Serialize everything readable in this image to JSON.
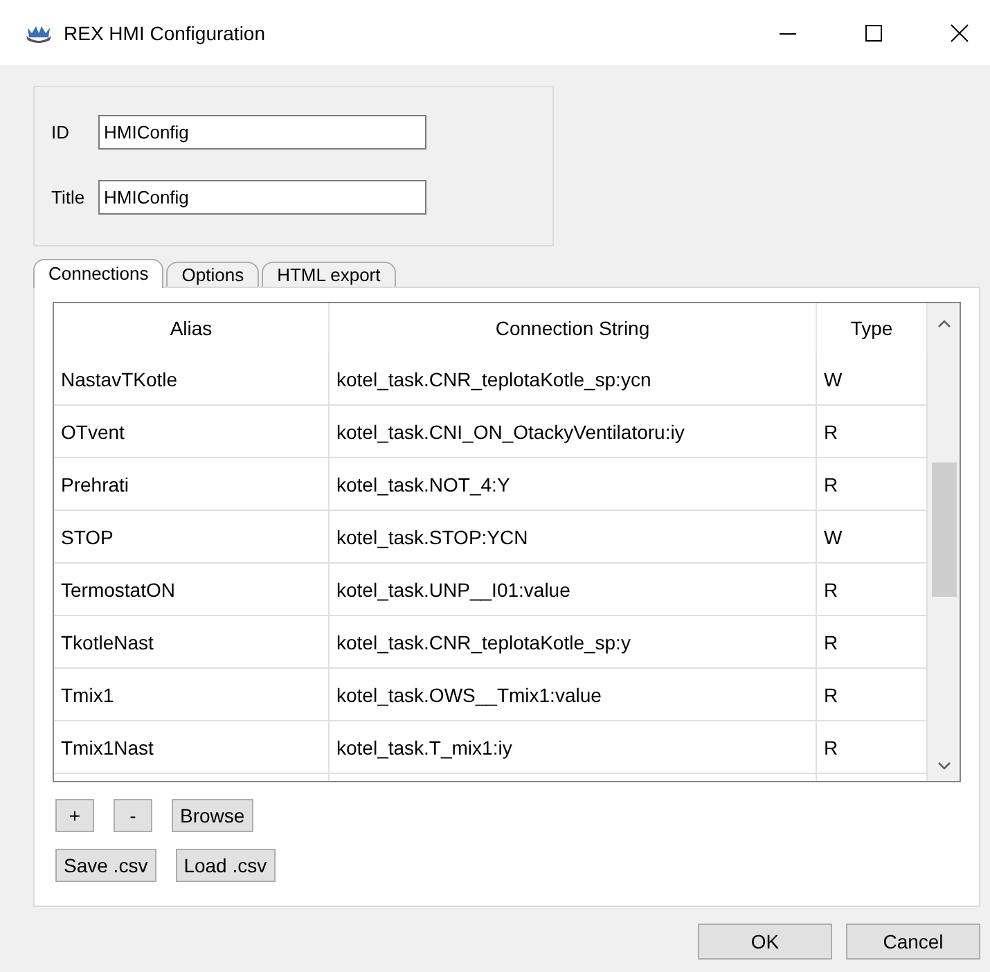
{
  "window": {
    "title": "REX HMI Configuration"
  },
  "fields": [
    {
      "label": "ID",
      "value": "HMIConfig"
    },
    {
      "label": "Title",
      "value": "HMIConfig"
    }
  ],
  "tabs": [
    {
      "label": "Connections",
      "selected": true
    },
    {
      "label": "Options",
      "selected": false
    },
    {
      "label": "HTML export",
      "selected": false
    }
  ],
  "table": {
    "columns": [
      "Alias",
      "Connection String",
      "Type"
    ],
    "rows": [
      [
        "NastavTKotle",
        "kotel_task.CNR_teplotaKotle_sp:ycn",
        "W"
      ],
      [
        "OTvent",
        "kotel_task.CNI_ON_OtackyVentilatoru:iy",
        "R"
      ],
      [
        "Prehrati",
        "kotel_task.NOT_4:Y",
        "R"
      ],
      [
        "STOP",
        "kotel_task.STOP:YCN",
        "W"
      ],
      [
        "TermostatON",
        "kotel_task.UNP__I01:value",
        "R"
      ],
      [
        "TkotleNast",
        "kotel_task.CNR_teplotaKotle_sp:y",
        "R"
      ],
      [
        "Tmix1",
        "kotel_task.OWS__Tmix1:value",
        "R"
      ],
      [
        "Tmix1Nast",
        "kotel_task.T_mix1:iy",
        "R"
      ]
    ]
  },
  "row_buttons": [
    "+",
    "-",
    "Browse"
  ],
  "csv_buttons": [
    "Save .csv",
    "Load .csv"
  ],
  "dialog_buttons": [
    "OK",
    "Cancel"
  ]
}
